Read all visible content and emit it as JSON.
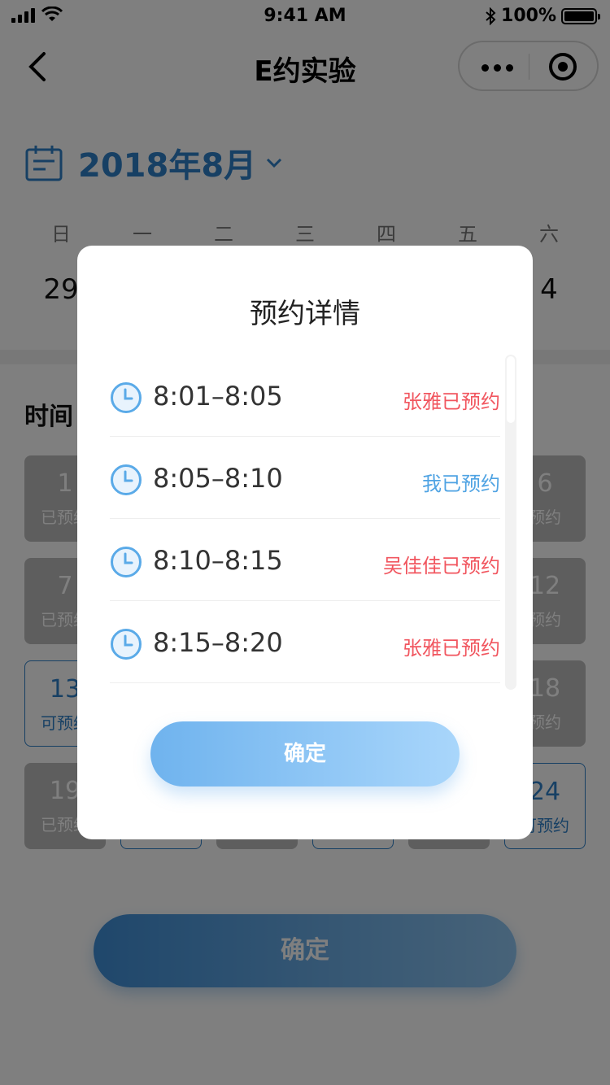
{
  "status_bar": {
    "time": "9:41 AM",
    "battery": "100%"
  },
  "nav": {
    "title": "E约实验"
  },
  "calendar": {
    "month": "2018年8月",
    "weekdays": [
      "日",
      "一",
      "二",
      "三",
      "四",
      "五",
      "六"
    ],
    "dates": [
      "29",
      "",
      "",
      "",
      "",
      "",
      "4"
    ]
  },
  "time_section": {
    "title": "时间"
  },
  "slots": [
    {
      "num": "1",
      "status": "已预约",
      "state": "booked"
    },
    {
      "num": "6",
      "status": "预约",
      "state": "booked"
    },
    {
      "num": "7",
      "status": "已预约",
      "state": "booked"
    },
    {
      "num": "12",
      "status": "预约",
      "state": "booked"
    },
    {
      "num": "13",
      "status": "可预约",
      "state": "free"
    },
    {
      "num": "18",
      "status": "预约",
      "state": "booked"
    },
    {
      "num": "19",
      "status": "已预约",
      "state": "booked"
    },
    {
      "num": "",
      "status": "",
      "state": "free"
    },
    {
      "num": "",
      "status": "",
      "state": "booked"
    },
    {
      "num": "",
      "status": "",
      "state": "free"
    },
    {
      "num": "",
      "status": "",
      "state": "booked"
    },
    {
      "num": "24",
      "status": "可预约",
      "state": "free"
    }
  ],
  "page_confirm_label": "确定",
  "modal": {
    "title": "预约详情",
    "rows": [
      {
        "time": "8:01–8:05",
        "who": "张雅已预约",
        "kind": "other"
      },
      {
        "time": "8:05–8:10",
        "who": "我已预约",
        "kind": "mine"
      },
      {
        "time": "8:10–8:15",
        "who": "吴佳佳已预约",
        "kind": "other"
      },
      {
        "time": "8:15–8:20",
        "who": "张雅已预约",
        "kind": "other"
      }
    ],
    "confirm_label": "确定"
  },
  "colors": {
    "accent": "#2f80c9",
    "reserved_other": "#f1565f",
    "reserved_mine": "#4fa3e3"
  }
}
